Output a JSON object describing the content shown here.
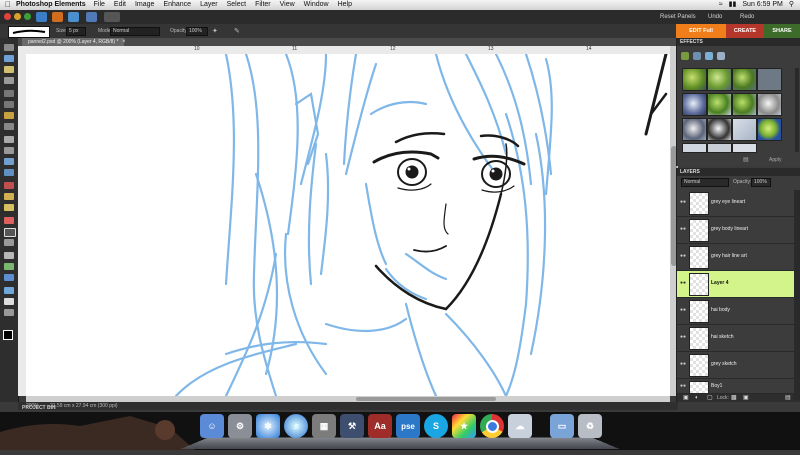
{
  "menubar": {
    "app_name": "Photoshop Elements",
    "items": [
      "File",
      "Edit",
      "Image",
      "Enhance",
      "Layer",
      "Select",
      "Filter",
      "View",
      "Window",
      "Help"
    ],
    "clock": "Sun 6:59 PM"
  },
  "appbar": {
    "reset_panels": "Reset Panels",
    "undo": "Undo",
    "redo": "Redo"
  },
  "options": {
    "size_label": "Size:",
    "size_value": "5 px",
    "mode_label": "Mode:",
    "mode_value": "Normal",
    "opacity_label": "Opacity:",
    "opacity_value": "100%"
  },
  "tabs": {
    "edit": "EDIT Full",
    "create": "CREATE",
    "share": "SHARE"
  },
  "document": {
    "tab_title": "pannel2.psd @ 200% (Layer 4, RGB/8) *",
    "zoom": "200%",
    "doc_info": "21.59 cm x 27.94 cm (300 ppi)",
    "ruler_labels": [
      "10",
      "11",
      "12",
      "13",
      "14"
    ]
  },
  "project_bin": "PROJECT BIN",
  "effects": {
    "title": "EFFECTS",
    "apply": "Apply"
  },
  "layers": {
    "title": "LAYERS",
    "blend_mode": "Normal",
    "opacity_label": "Opacity:",
    "opacity_value": "100%",
    "lock_label": "Lock:",
    "items": [
      {
        "name": "grey eye lineart",
        "selected": false
      },
      {
        "name": "grey body lineart",
        "selected": false
      },
      {
        "name": "grey hair line art",
        "selected": false
      },
      {
        "name": "Layer 4",
        "selected": true
      },
      {
        "name": "hai body",
        "selected": false
      },
      {
        "name": "hai sketch",
        "selected": false
      },
      {
        "name": "grey sketch",
        "selected": false
      },
      {
        "name": "Boy1",
        "selected": false
      }
    ]
  },
  "dock": {
    "apps": [
      "finder-icon",
      "system-preferences-icon",
      "safari-icon",
      "itunes-icon",
      "calculator-icon",
      "xcode-icon",
      "dictionary-icon",
      "pse-icon",
      "skype-icon",
      "game-center-icon",
      "chrome-icon",
      "preview-icon",
      "folder-icon",
      "trash-icon"
    ],
    "labels": {
      "dictionary": "Aa",
      "pse": "pse",
      "skype": "S"
    }
  },
  "colors": {
    "sketch_blue": "#7fb7e8",
    "lineart": "#1a1a1a",
    "edit_tab": "#f07e1b",
    "create_tab": "#b5362b",
    "share_tab": "#3d6b2a",
    "selected_layer": "#d3f48a"
  }
}
